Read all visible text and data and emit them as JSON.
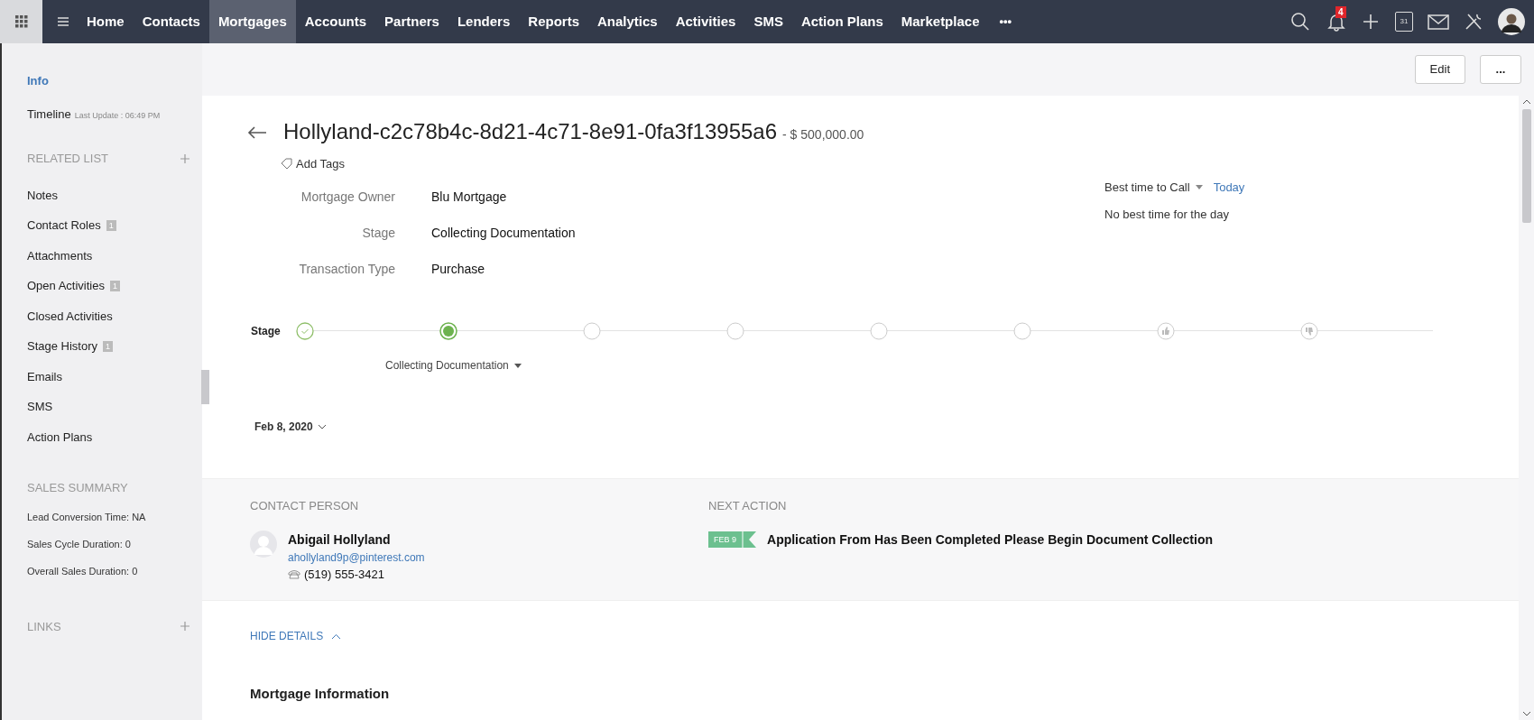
{
  "nav": {
    "items": [
      {
        "label": "Home",
        "selected": false
      },
      {
        "label": "Contacts",
        "selected": false
      },
      {
        "label": "Mortgages",
        "selected": true
      },
      {
        "label": "Accounts",
        "selected": false
      },
      {
        "label": "Partners",
        "selected": false
      },
      {
        "label": "Lenders",
        "selected": false
      },
      {
        "label": "Reports",
        "selected": false
      },
      {
        "label": "Analytics",
        "selected": false
      },
      {
        "label": "Activities",
        "selected": false
      },
      {
        "label": "SMS",
        "selected": false
      },
      {
        "label": "Action Plans",
        "selected": false
      },
      {
        "label": "Marketplace",
        "selected": false
      }
    ],
    "more": "•••",
    "notifications": "4",
    "calendar_day": "31"
  },
  "sidebar": {
    "items": [
      {
        "label": "Info",
        "selected": true
      },
      {
        "label": "Timeline",
        "selected": false,
        "note": "Last Update : 06:49 PM"
      }
    ],
    "related_title": "RELATED LIST",
    "related": [
      {
        "label": "Notes"
      },
      {
        "label": "Contact Roles",
        "count": "1"
      },
      {
        "label": "Attachments"
      },
      {
        "label": "Open Activities",
        "count": "1"
      },
      {
        "label": "Closed Activities"
      },
      {
        "label": "Stage History",
        "count": "1"
      },
      {
        "label": "Emails"
      },
      {
        "label": "SMS"
      },
      {
        "label": "Action Plans"
      }
    ],
    "summary_title": "SALES SUMMARY",
    "summary": [
      "Lead Conversion Time: NA",
      "Sales Cycle Duration: 0",
      "Overall Sales Duration: 0"
    ],
    "links_title": "LINKS"
  },
  "toolbar": {
    "edit": "Edit",
    "more": "..."
  },
  "record": {
    "title": "Hollyland-c2c78b4c-8d21-4c71-8e91-0fa3f13955a6",
    "amount": "- $ 500,000.00",
    "add_tags": "Add Tags",
    "fields": [
      {
        "label": "Mortgage Owner",
        "value": "Blu Mortgage"
      },
      {
        "label": "Stage",
        "value": "Collecting Documentation"
      },
      {
        "label": "Transaction Type",
        "value": "Purchase"
      }
    ],
    "best_time": {
      "label": "Best time to Call",
      "day": "Today",
      "note": "No best time for the day"
    }
  },
  "stage_bar": {
    "label": "Stage",
    "current_label": "Collecting Documentation",
    "date": "Feb 8, 2020",
    "stages": [
      {
        "kind": "done"
      },
      {
        "kind": "current"
      },
      {
        "kind": "pending"
      },
      {
        "kind": "pending"
      },
      {
        "kind": "pending"
      },
      {
        "kind": "pending"
      },
      {
        "kind": "won"
      },
      {
        "kind": "lost"
      }
    ]
  },
  "contact": {
    "title": "CONTACT PERSON",
    "name": "Abigail Hollyland",
    "email": "ahollyland9p@pinterest.com",
    "phone": "(519) 555-3421"
  },
  "next_action": {
    "title": "NEXT ACTION",
    "date": "FEB 9",
    "text": "Application From Has Been Completed Please Begin Document Collection"
  },
  "details": {
    "toggle": "HIDE DETAILS",
    "section": "Mortgage Information"
  }
}
